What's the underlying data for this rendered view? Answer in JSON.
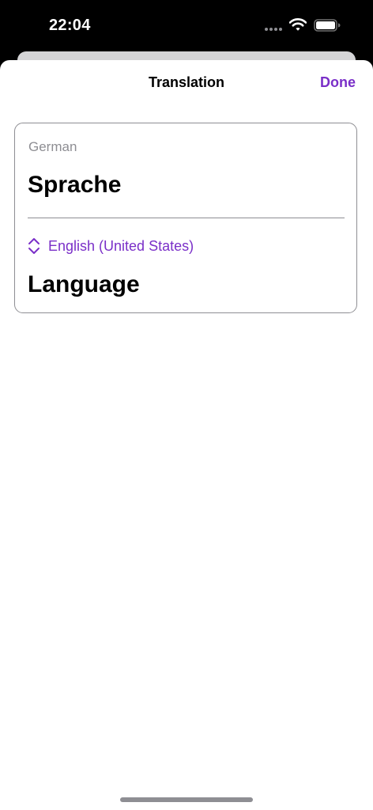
{
  "status_bar": {
    "time": "22:04",
    "wifi_icon": "wifi-icon",
    "battery_icon": "battery-icon"
  },
  "nav": {
    "title": "Translation",
    "done_label": "Done"
  },
  "translation": {
    "source_language": "German",
    "source_text": "Sprache",
    "target_language": "English (United States)",
    "target_language_icon": "chevron-up-down-icon",
    "target_text": "Language"
  },
  "colors": {
    "accent": "#7a2fc8",
    "secondary_text": "#8e8e93",
    "sheet_background": "#ffffff",
    "status_bar_background": "#000000"
  }
}
